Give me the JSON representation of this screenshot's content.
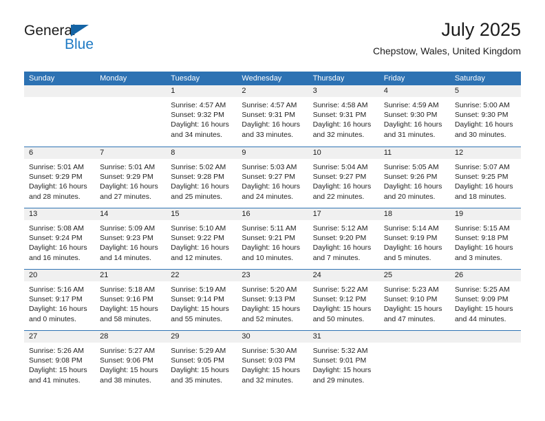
{
  "brand": {
    "name_top": "General",
    "name_bottom": "Blue",
    "triangle_color": "#1464a5",
    "blue_color": "#1f7ac4"
  },
  "header": {
    "title": "July 2025",
    "subtitle": "Chepstow, Wales, United Kingdom",
    "accent_color": "#2d72b3",
    "daynum_band_color": "#f0f0f0"
  },
  "weekdays": [
    "Sunday",
    "Monday",
    "Tuesday",
    "Wednesday",
    "Thursday",
    "Friday",
    "Saturday"
  ],
  "labels": {
    "sunrise_prefix": "Sunrise: ",
    "sunset_prefix": "Sunset: ",
    "daylight_prefix": "Daylight: "
  },
  "weeks": [
    [
      {
        "day": ""
      },
      {
        "day": ""
      },
      {
        "day": "1",
        "sunrise": "Sunrise: 4:57 AM",
        "sunset": "Sunset: 9:32 PM",
        "daylight_line1": "Daylight: 16 hours",
        "daylight_line2": "and 34 minutes."
      },
      {
        "day": "2",
        "sunrise": "Sunrise: 4:57 AM",
        "sunset": "Sunset: 9:31 PM",
        "daylight_line1": "Daylight: 16 hours",
        "daylight_line2": "and 33 minutes."
      },
      {
        "day": "3",
        "sunrise": "Sunrise: 4:58 AM",
        "sunset": "Sunset: 9:31 PM",
        "daylight_line1": "Daylight: 16 hours",
        "daylight_line2": "and 32 minutes."
      },
      {
        "day": "4",
        "sunrise": "Sunrise: 4:59 AM",
        "sunset": "Sunset: 9:30 PM",
        "daylight_line1": "Daylight: 16 hours",
        "daylight_line2": "and 31 minutes."
      },
      {
        "day": "5",
        "sunrise": "Sunrise: 5:00 AM",
        "sunset": "Sunset: 9:30 PM",
        "daylight_line1": "Daylight: 16 hours",
        "daylight_line2": "and 30 minutes."
      }
    ],
    [
      {
        "day": "6",
        "sunrise": "Sunrise: 5:01 AM",
        "sunset": "Sunset: 9:29 PM",
        "daylight_line1": "Daylight: 16 hours",
        "daylight_line2": "and 28 minutes."
      },
      {
        "day": "7",
        "sunrise": "Sunrise: 5:01 AM",
        "sunset": "Sunset: 9:29 PM",
        "daylight_line1": "Daylight: 16 hours",
        "daylight_line2": "and 27 minutes."
      },
      {
        "day": "8",
        "sunrise": "Sunrise: 5:02 AM",
        "sunset": "Sunset: 9:28 PM",
        "daylight_line1": "Daylight: 16 hours",
        "daylight_line2": "and 25 minutes."
      },
      {
        "day": "9",
        "sunrise": "Sunrise: 5:03 AM",
        "sunset": "Sunset: 9:27 PM",
        "daylight_line1": "Daylight: 16 hours",
        "daylight_line2": "and 24 minutes."
      },
      {
        "day": "10",
        "sunrise": "Sunrise: 5:04 AM",
        "sunset": "Sunset: 9:27 PM",
        "daylight_line1": "Daylight: 16 hours",
        "daylight_line2": "and 22 minutes."
      },
      {
        "day": "11",
        "sunrise": "Sunrise: 5:05 AM",
        "sunset": "Sunset: 9:26 PM",
        "daylight_line1": "Daylight: 16 hours",
        "daylight_line2": "and 20 minutes."
      },
      {
        "day": "12",
        "sunrise": "Sunrise: 5:07 AM",
        "sunset": "Sunset: 9:25 PM",
        "daylight_line1": "Daylight: 16 hours",
        "daylight_line2": "and 18 minutes."
      }
    ],
    [
      {
        "day": "13",
        "sunrise": "Sunrise: 5:08 AM",
        "sunset": "Sunset: 9:24 PM",
        "daylight_line1": "Daylight: 16 hours",
        "daylight_line2": "and 16 minutes."
      },
      {
        "day": "14",
        "sunrise": "Sunrise: 5:09 AM",
        "sunset": "Sunset: 9:23 PM",
        "daylight_line1": "Daylight: 16 hours",
        "daylight_line2": "and 14 minutes."
      },
      {
        "day": "15",
        "sunrise": "Sunrise: 5:10 AM",
        "sunset": "Sunset: 9:22 PM",
        "daylight_line1": "Daylight: 16 hours",
        "daylight_line2": "and 12 minutes."
      },
      {
        "day": "16",
        "sunrise": "Sunrise: 5:11 AM",
        "sunset": "Sunset: 9:21 PM",
        "daylight_line1": "Daylight: 16 hours",
        "daylight_line2": "and 10 minutes."
      },
      {
        "day": "17",
        "sunrise": "Sunrise: 5:12 AM",
        "sunset": "Sunset: 9:20 PM",
        "daylight_line1": "Daylight: 16 hours",
        "daylight_line2": "and 7 minutes."
      },
      {
        "day": "18",
        "sunrise": "Sunrise: 5:14 AM",
        "sunset": "Sunset: 9:19 PM",
        "daylight_line1": "Daylight: 16 hours",
        "daylight_line2": "and 5 minutes."
      },
      {
        "day": "19",
        "sunrise": "Sunrise: 5:15 AM",
        "sunset": "Sunset: 9:18 PM",
        "daylight_line1": "Daylight: 16 hours",
        "daylight_line2": "and 3 minutes."
      }
    ],
    [
      {
        "day": "20",
        "sunrise": "Sunrise: 5:16 AM",
        "sunset": "Sunset: 9:17 PM",
        "daylight_line1": "Daylight: 16 hours",
        "daylight_line2": "and 0 minutes."
      },
      {
        "day": "21",
        "sunrise": "Sunrise: 5:18 AM",
        "sunset": "Sunset: 9:16 PM",
        "daylight_line1": "Daylight: 15 hours",
        "daylight_line2": "and 58 minutes."
      },
      {
        "day": "22",
        "sunrise": "Sunrise: 5:19 AM",
        "sunset": "Sunset: 9:14 PM",
        "daylight_line1": "Daylight: 15 hours",
        "daylight_line2": "and 55 minutes."
      },
      {
        "day": "23",
        "sunrise": "Sunrise: 5:20 AM",
        "sunset": "Sunset: 9:13 PM",
        "daylight_line1": "Daylight: 15 hours",
        "daylight_line2": "and 52 minutes."
      },
      {
        "day": "24",
        "sunrise": "Sunrise: 5:22 AM",
        "sunset": "Sunset: 9:12 PM",
        "daylight_line1": "Daylight: 15 hours",
        "daylight_line2": "and 50 minutes."
      },
      {
        "day": "25",
        "sunrise": "Sunrise: 5:23 AM",
        "sunset": "Sunset: 9:10 PM",
        "daylight_line1": "Daylight: 15 hours",
        "daylight_line2": "and 47 minutes."
      },
      {
        "day": "26",
        "sunrise": "Sunrise: 5:25 AM",
        "sunset": "Sunset: 9:09 PM",
        "daylight_line1": "Daylight: 15 hours",
        "daylight_line2": "and 44 minutes."
      }
    ],
    [
      {
        "day": "27",
        "sunrise": "Sunrise: 5:26 AM",
        "sunset": "Sunset: 9:08 PM",
        "daylight_line1": "Daylight: 15 hours",
        "daylight_line2": "and 41 minutes."
      },
      {
        "day": "28",
        "sunrise": "Sunrise: 5:27 AM",
        "sunset": "Sunset: 9:06 PM",
        "daylight_line1": "Daylight: 15 hours",
        "daylight_line2": "and 38 minutes."
      },
      {
        "day": "29",
        "sunrise": "Sunrise: 5:29 AM",
        "sunset": "Sunset: 9:05 PM",
        "daylight_line1": "Daylight: 15 hours",
        "daylight_line2": "and 35 minutes."
      },
      {
        "day": "30",
        "sunrise": "Sunrise: 5:30 AM",
        "sunset": "Sunset: 9:03 PM",
        "daylight_line1": "Daylight: 15 hours",
        "daylight_line2": "and 32 minutes."
      },
      {
        "day": "31",
        "sunrise": "Sunrise: 5:32 AM",
        "sunset": "Sunset: 9:01 PM",
        "daylight_line1": "Daylight: 15 hours",
        "daylight_line2": "and 29 minutes."
      },
      {
        "day": ""
      },
      {
        "day": ""
      }
    ]
  ]
}
